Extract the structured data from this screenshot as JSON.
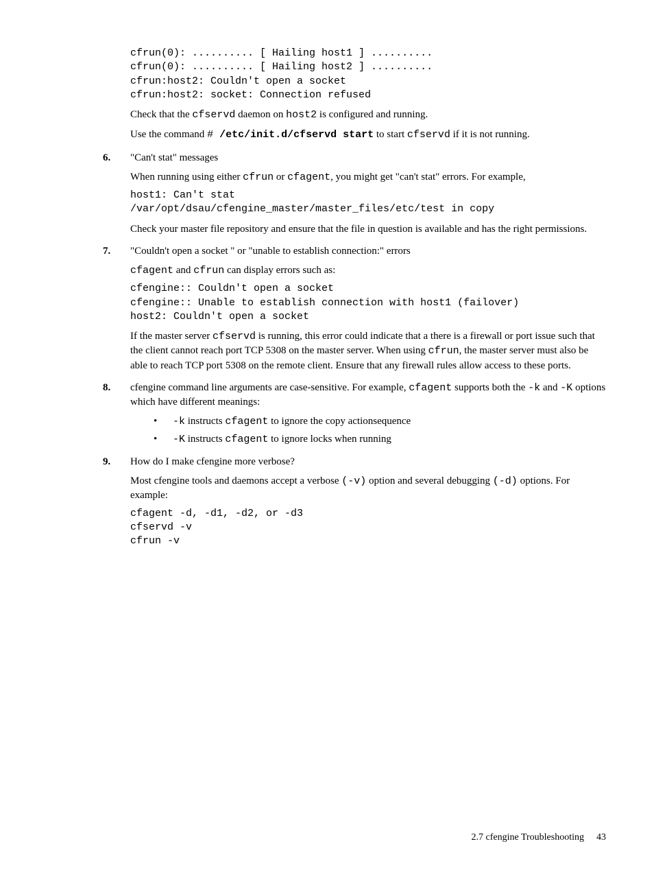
{
  "code1": "cfrun(0): .......... [ Hailing host1 ] ..........\ncfrun(0): .......... [ Hailing host2 ] ..........\ncfrun:host2: Couldn't open a socket\ncfrun:host2: socket: Connection refused",
  "p1_a": "Check that the ",
  "p1_b": "cfservd",
  "p1_c": " daemon on ",
  "p1_d": "host2",
  "p1_e": " is configured and running.",
  "p2_a": "Use the command ",
  "p2_b": "# ",
  "p2_c": "/etc/init.d/cfservd start",
  "p2_d": " to start ",
  "p2_e": "cfservd",
  "p2_f": " if it is not running.",
  "item6_num": "6.",
  "item6_title": "\"Can't stat\" messages",
  "item6_p1_a": "When running using either ",
  "item6_p1_b": "cfrun",
  "item6_p1_c": " or ",
  "item6_p1_d": "cfagent",
  "item6_p1_e": ", you might get \"can't stat\" errors. For example,",
  "code2": "host1: Can't stat\n/var/opt/dsau/cfengine_master/master_files/etc/test in copy",
  "item6_p2": "Check your master file repository and ensure that the file in question is available and has the right permissions.",
  "item7_num": "7.",
  "item7_title": "\"Couldn't open a socket \" or \"unable to establish connection:\" errors",
  "item7_p1_a": "cfagent",
  "item7_p1_b": " and ",
  "item7_p1_c": "cfrun",
  "item7_p1_d": " can display errors such as:",
  "code3": "cfengine:: Couldn't open a socket\ncfengine:: Unable to establish connection with host1 (failover)\nhost2: Couldn't open a socket",
  "item7_p2_a": "If the master server ",
  "item7_p2_b": "cfservd",
  "item7_p2_c": " is running, this error could indicate that a there is a firewall or port issue such that the client cannot reach port TCP 5308 on the master server. When using ",
  "item7_p2_d": "cfrun",
  "item7_p2_e": ", the master server must also be able to reach TCP port 5308 on the remote client. Ensure that any firewall rules allow access to these ports.",
  "item8_num": "8.",
  "item8_p1_a": "cfengine command line arguments are case-sensitive. For example, ",
  "item8_p1_b": "cfagent",
  "item8_p1_c": " supports both the ",
  "item8_p1_d": "-k",
  "item8_p1_e": " and ",
  "item8_p1_f": "-K",
  "item8_p1_g": " options which have different meanings:",
  "item8_b1_a": "-k",
  "item8_b1_b": " instructs ",
  "item8_b1_c": "cfagent",
  "item8_b1_d": " to ignore the copy actionsequence",
  "item8_b2_a": "-K",
  "item8_b2_b": " instructs ",
  "item8_b2_c": "cfagent",
  "item8_b2_d": " to ignore locks when running",
  "item9_num": "9.",
  "item9_title": "How do I make cfengine more verbose?",
  "item9_p1_a": "Most cfengine tools and daemons accept a verbose ",
  "item9_p1_b": "(-v)",
  "item9_p1_c": " option and several debugging ",
  "item9_p1_d": "(-d)",
  "item9_p1_e": " options. For example:",
  "code4": "cfagent -d, -d1, -d2, or -d3\ncfservd -v\ncfrun -v",
  "footer_section": "2.7 cfengine Troubleshooting",
  "footer_page": "43"
}
